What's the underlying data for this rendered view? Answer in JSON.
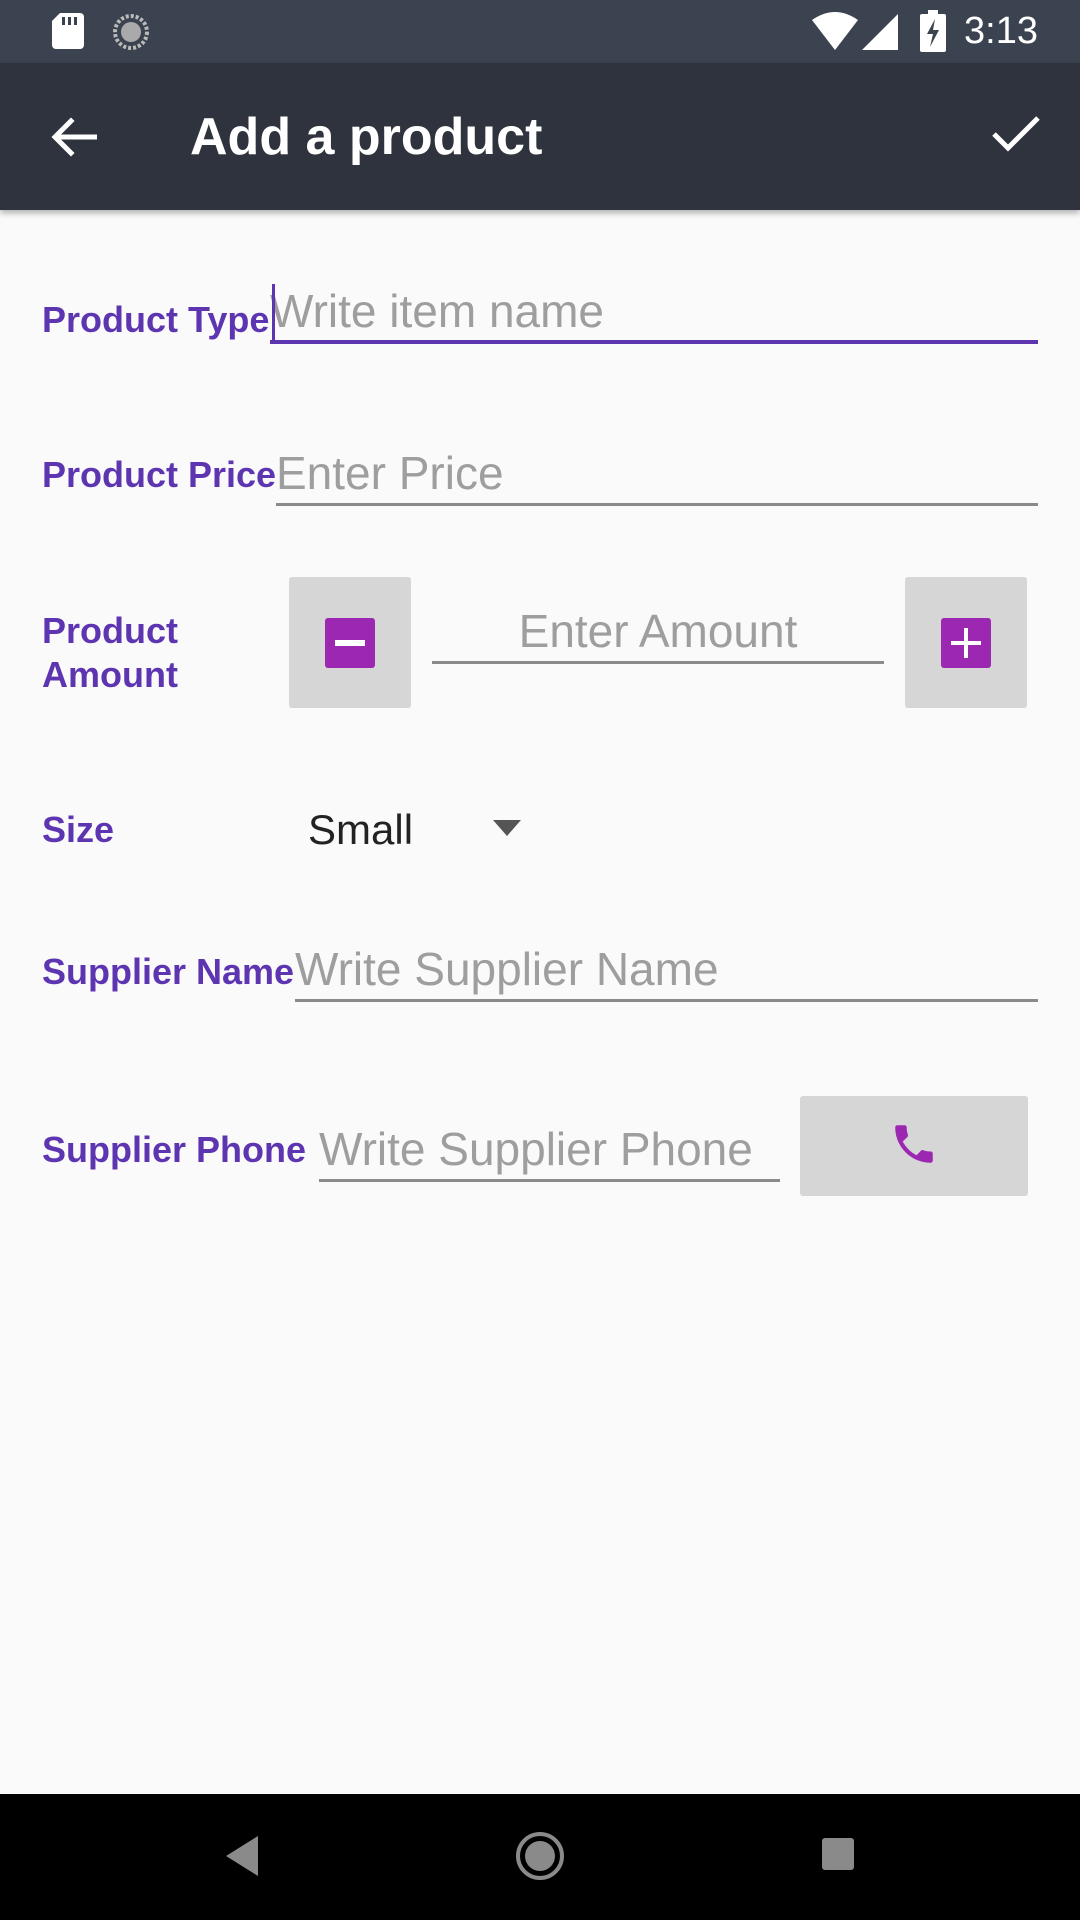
{
  "status_bar": {
    "time": "3:13",
    "icons": [
      "sd-card-icon",
      "sync-icon",
      "wifi-icon",
      "signal-icon",
      "battery-charging-icon"
    ]
  },
  "app_bar": {
    "title": "Add a product",
    "back_icon": "arrow-left-icon",
    "save_icon": "check-icon"
  },
  "form": {
    "product_type": {
      "label": "Product Type",
      "placeholder": "Write item name",
      "value": ""
    },
    "product_price": {
      "label": "Product Price",
      "placeholder": "Enter Price",
      "value": ""
    },
    "product_amount": {
      "label": "Product Amount",
      "placeholder": "Enter Amount",
      "value": ""
    },
    "size": {
      "label": "Size",
      "selected": "Small"
    },
    "supplier_name": {
      "label": "Supplier Name",
      "placeholder": "Write Supplier Name",
      "value": ""
    },
    "supplier_phone": {
      "label": "Supplier Phone",
      "placeholder": "Write Supplier Phone",
      "value": ""
    }
  },
  "colors": {
    "accent": "#5e35b1",
    "button_fill": "#9c27b0",
    "app_bar": "#2e333d",
    "status_bar": "#3b4350"
  },
  "nav_bar": {
    "icons": [
      "nav-back-icon",
      "nav-home-icon",
      "nav-recents-icon"
    ]
  }
}
